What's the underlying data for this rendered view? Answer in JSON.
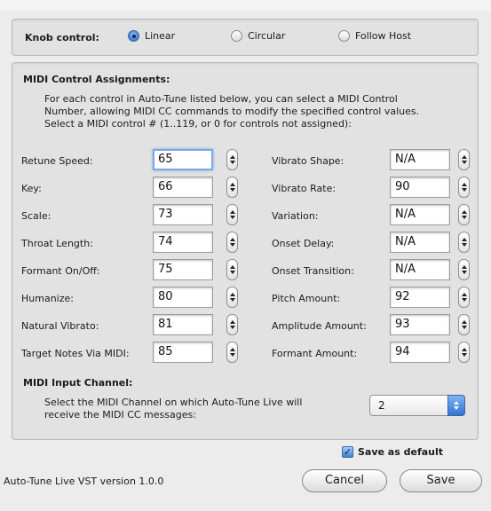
{
  "knob": {
    "label": "Knob control:",
    "options": [
      "Linear",
      "Circular",
      "Follow Host"
    ],
    "selected": "Linear"
  },
  "assignments": {
    "title": "MIDI Control Assignments:",
    "description_lines": [
      "For each control in Auto-Tune listed below, you can select a MIDI Control",
      "Number, allowing MIDI CC commands to modify the specified control values.",
      "Select a MIDI control # (1..119, or 0 for controls not assigned):"
    ],
    "left_controls": [
      {
        "label": "Retune Speed:",
        "value": "65"
      },
      {
        "label": "Key:",
        "value": "66"
      },
      {
        "label": "Scale:",
        "value": "73"
      },
      {
        "label": "Throat Length:",
        "value": "74"
      },
      {
        "label": "Formant On/Off:",
        "value": "75"
      },
      {
        "label": "Humanize:",
        "value": "80"
      },
      {
        "label": "Natural Vibrato:",
        "value": "81"
      },
      {
        "label": "Target Notes Via MIDI:",
        "value": "85"
      }
    ],
    "right_controls": [
      {
        "label": "Vibrato Shape:",
        "value": "N/A"
      },
      {
        "label": "Vibrato Rate:",
        "value": "90"
      },
      {
        "label": "Variation:",
        "value": "N/A"
      },
      {
        "label": "Onset Delay:",
        "value": "N/A"
      },
      {
        "label": "Onset Transition:",
        "value": "N/A"
      },
      {
        "label": "Pitch Amount:",
        "value": "92"
      },
      {
        "label": "Amplitude Amount:",
        "value": "93"
      },
      {
        "label": "Formant Amount:",
        "value": "94"
      }
    ]
  },
  "midi_input": {
    "title": "MIDI Input Channel:",
    "description_lines": [
      "Select the MIDI Channel on which Auto-Tune Live will",
      "receive the MIDI CC messages:"
    ],
    "channel": "2"
  },
  "footer": {
    "save_default_label": "Save as default",
    "save_default_checked": true,
    "version": "Auto-Tune Live VST version 1.0.0",
    "cancel_label": "Cancel",
    "save_label": "Save"
  },
  "colors": {
    "accent": "#3d7cd0",
    "panel": "#e2e2e2",
    "window": "#ececec"
  }
}
